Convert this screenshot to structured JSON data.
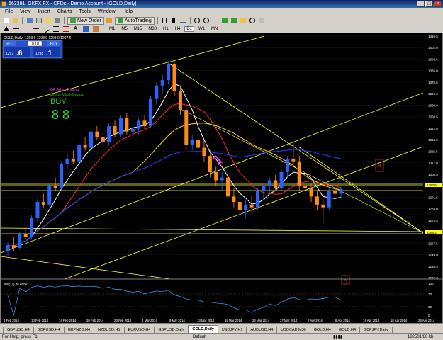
{
  "window": {
    "title": "663391: GKFX FX - CFDs - Demo Account - [GOLD,Daily]"
  },
  "menu": [
    "File",
    "View",
    "Insert",
    "Charts",
    "Tools",
    "Window",
    "Help"
  ],
  "toolbar": {
    "new_order": "New Order",
    "autotrading": "AutoTrading"
  },
  "timeframes": [
    "M1",
    "M5",
    "M15",
    "M30",
    "H1",
    "H4",
    "D1",
    "W1",
    "MN"
  ],
  "chart": {
    "symbol_label": "GOLD,Daily",
    "ohlc": "1293.6 1298.0 1293.0 1297.6",
    "one_click": {
      "sell": "SELL",
      "buy": "BUY",
      "lot": "0.10",
      "sell_big": "1297",
      "sell_small": ".6",
      "buy_big": "1298",
      "buy_small": ".1"
    },
    "indicator_name_1": "GP Jebus Trading",
    "indicator_name_2": "Jebus Mash Bagus",
    "signal": "BUY",
    "price_ticks": [
      "1410.5",
      "1402.0",
      "1393.5",
      "1385.0",
      "1376.6",
      "1366.6",
      "1359.0",
      "1350.5",
      "1342.0",
      "1334.0",
      "1325.5",
      "1317.0",
      "1308.5",
      "1300.0",
      "1291.5",
      "1283.0",
      "1274.5",
      "1266.0",
      "1257.5",
      "1249.0",
      "1240.5",
      "1232.0"
    ],
    "price_levels": {
      "current": "1297.6",
      "support": "1268.2"
    },
    "date_ticks": [
      "4 Feb 2014",
      "10 Feb 2014",
      "14 Feb 2014",
      "20 Feb 2014",
      "26 Feb 2014",
      "4 Mar 2014",
      "9 Mar 2014",
      "13 Mar 2014",
      "18 Mar 2014",
      "23 Mar 2014",
      "27 Mar 2014",
      "2 Apr 2014",
      "8 Apr 2014",
      "14 Apr 2014",
      "18 Apr 2014",
      "24 Apr 2014"
    ],
    "rsi_label": "RSI(14) 46.6000",
    "rsi_ticks": [
      "100",
      "70",
      "30",
      "0"
    ]
  },
  "chart_data": {
    "type": "candlestick",
    "symbol": "GOLD",
    "timeframe": "Daily",
    "ylim": [
      1232,
      1410.5
    ],
    "candles": [
      {
        "o": 1252,
        "h": 1258,
        "l": 1248,
        "c": 1256
      },
      {
        "o": 1256,
        "h": 1262,
        "l": 1252,
        "c": 1254
      },
      {
        "o": 1254,
        "h": 1266,
        "l": 1253,
        "c": 1264
      },
      {
        "o": 1264,
        "h": 1270,
        "l": 1260,
        "c": 1262
      },
      {
        "o": 1262,
        "h": 1278,
        "l": 1260,
        "c": 1276
      },
      {
        "o": 1276,
        "h": 1290,
        "l": 1273,
        "c": 1288
      },
      {
        "o": 1288,
        "h": 1294,
        "l": 1284,
        "c": 1286
      },
      {
        "o": 1286,
        "h": 1302,
        "l": 1285,
        "c": 1300
      },
      {
        "o": 1300,
        "h": 1306,
        "l": 1296,
        "c": 1298
      },
      {
        "o": 1298,
        "h": 1318,
        "l": 1297,
        "c": 1316
      },
      {
        "o": 1316,
        "h": 1324,
        "l": 1312,
        "c": 1320
      },
      {
        "o": 1320,
        "h": 1326,
        "l": 1316,
        "c": 1318
      },
      {
        "o": 1318,
        "h": 1332,
        "l": 1317,
        "c": 1330
      },
      {
        "o": 1330,
        "h": 1336,
        "l": 1326,
        "c": 1328
      },
      {
        "o": 1328,
        "h": 1342,
        "l": 1326,
        "c": 1340
      },
      {
        "o": 1340,
        "h": 1344,
        "l": 1334,
        "c": 1336
      },
      {
        "o": 1336,
        "h": 1340,
        "l": 1330,
        "c": 1332
      },
      {
        "o": 1332,
        "h": 1346,
        "l": 1330,
        "c": 1344
      },
      {
        "o": 1344,
        "h": 1348,
        "l": 1336,
        "c": 1338
      },
      {
        "o": 1338,
        "h": 1352,
        "l": 1336,
        "c": 1350
      },
      {
        "o": 1350,
        "h": 1354,
        "l": 1338,
        "c": 1340
      },
      {
        "o": 1340,
        "h": 1346,
        "l": 1334,
        "c": 1342
      },
      {
        "o": 1342,
        "h": 1350,
        "l": 1338,
        "c": 1348
      },
      {
        "o": 1348,
        "h": 1352,
        "l": 1342,
        "c": 1344
      },
      {
        "o": 1344,
        "h": 1366,
        "l": 1343,
        "c": 1364
      },
      {
        "o": 1364,
        "h": 1376,
        "l": 1360,
        "c": 1374
      },
      {
        "o": 1374,
        "h": 1382,
        "l": 1368,
        "c": 1378
      },
      {
        "o": 1378,
        "h": 1392,
        "l": 1375,
        "c": 1390
      },
      {
        "o": 1390,
        "h": 1392,
        "l": 1366,
        "c": 1370
      },
      {
        "o": 1370,
        "h": 1374,
        "l": 1352,
        "c": 1356
      },
      {
        "o": 1356,
        "h": 1360,
        "l": 1326,
        "c": 1330
      },
      {
        "o": 1330,
        "h": 1338,
        "l": 1326,
        "c": 1334
      },
      {
        "o": 1334,
        "h": 1340,
        "l": 1322,
        "c": 1328
      },
      {
        "o": 1328,
        "h": 1334,
        "l": 1318,
        "c": 1322
      },
      {
        "o": 1322,
        "h": 1326,
        "l": 1306,
        "c": 1310
      },
      {
        "o": 1310,
        "h": 1314,
        "l": 1300,
        "c": 1304
      },
      {
        "o": 1304,
        "h": 1310,
        "l": 1296,
        "c": 1306
      },
      {
        "o": 1306,
        "h": 1308,
        "l": 1288,
        "c": 1292
      },
      {
        "o": 1292,
        "h": 1298,
        "l": 1284,
        "c": 1288
      },
      {
        "o": 1288,
        "h": 1294,
        "l": 1278,
        "c": 1282
      },
      {
        "o": 1282,
        "h": 1290,
        "l": 1276,
        "c": 1286
      },
      {
        "o": 1286,
        "h": 1292,
        "l": 1280,
        "c": 1284
      },
      {
        "o": 1284,
        "h": 1298,
        "l": 1282,
        "c": 1296
      },
      {
        "o": 1296,
        "h": 1302,
        "l": 1290,
        "c": 1300
      },
      {
        "o": 1300,
        "h": 1306,
        "l": 1294,
        "c": 1304
      },
      {
        "o": 1304,
        "h": 1308,
        "l": 1296,
        "c": 1298
      },
      {
        "o": 1298,
        "h": 1312,
        "l": 1297,
        "c": 1310
      },
      {
        "o": 1310,
        "h": 1322,
        "l": 1306,
        "c": 1320
      },
      {
        "o": 1320,
        "h": 1332,
        "l": 1316,
        "c": 1318
      },
      {
        "o": 1318,
        "h": 1322,
        "l": 1296,
        "c": 1300
      },
      {
        "o": 1300,
        "h": 1304,
        "l": 1290,
        "c": 1298
      },
      {
        "o": 1298,
        "h": 1302,
        "l": 1288,
        "c": 1292
      },
      {
        "o": 1292,
        "h": 1296,
        "l": 1282,
        "c": 1286
      },
      {
        "o": 1286,
        "h": 1290,
        "l": 1272,
        "c": 1284
      },
      {
        "o": 1284,
        "h": 1298,
        "l": 1282,
        "c": 1296
      },
      {
        "o": 1296,
        "h": 1298,
        "l": 1290,
        "c": 1294
      },
      {
        "o": 1294,
        "h": 1299,
        "l": 1291,
        "c": 1297.6
      }
    ],
    "moving_averages": [
      {
        "name": "fast",
        "color": "#ffffff"
      },
      {
        "name": "mid",
        "color": "#ff2a2a"
      },
      {
        "name": "slow",
        "color": "#ffd21a"
      },
      {
        "name": "long",
        "color": "#2040ff"
      }
    ],
    "rsi": {
      "value": 46.6,
      "levels": [
        70,
        30
      ]
    }
  }
}
